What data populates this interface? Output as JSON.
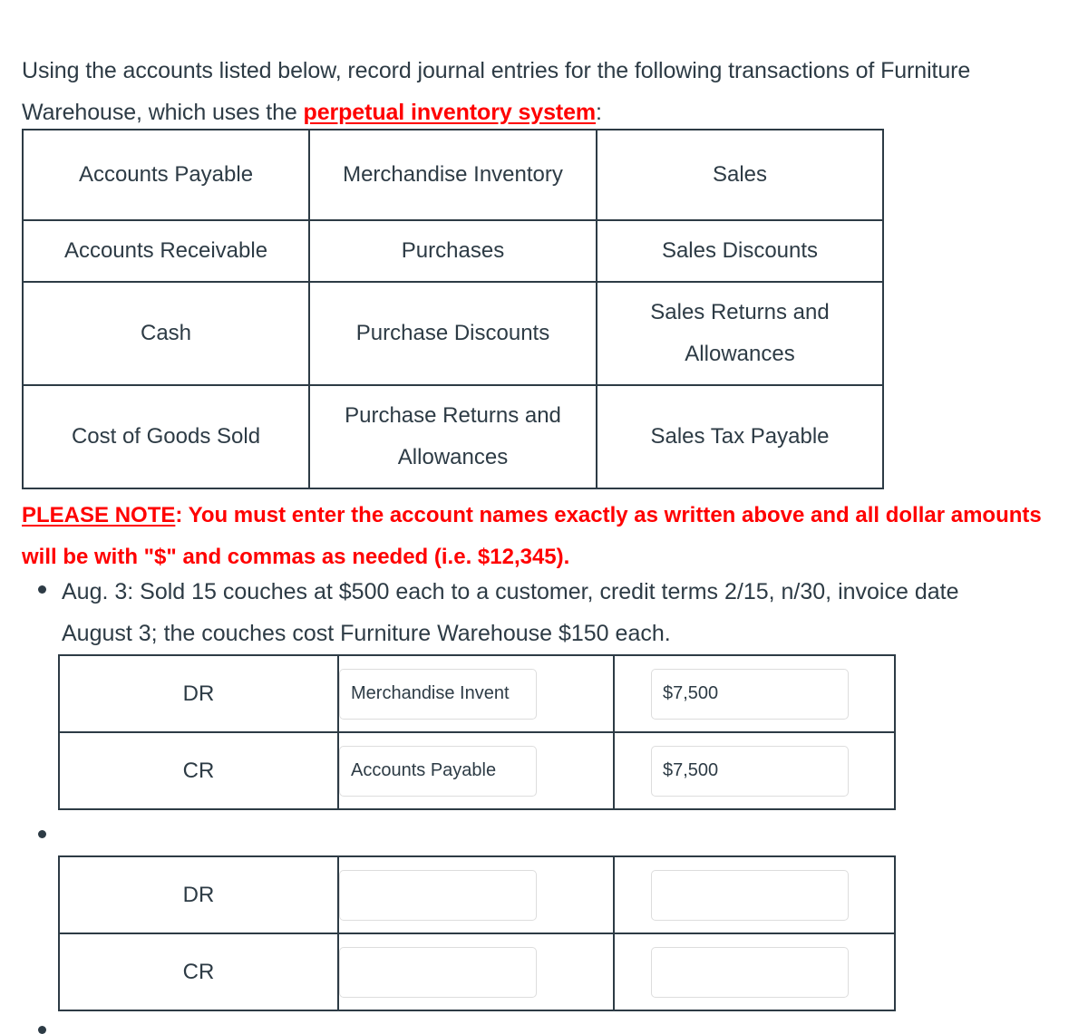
{
  "intro": {
    "part1": "Using the accounts listed below, record journal entries for the following transactions of Furniture Warehouse, which uses the ",
    "emphasis": "perpetual inventory system",
    "part2": ":"
  },
  "accounts_table": {
    "rows": [
      [
        "Accounts Payable",
        "Merchandise Inventory",
        "Sales"
      ],
      [
        "Accounts Receivable",
        "Purchases",
        "Sales Discounts"
      ],
      [
        "Cash",
        "Purchase Discounts",
        "Sales Returns and Allowances"
      ],
      [
        "Cost of Goods Sold",
        "Purchase Returns and Allowances",
        "Sales Tax Payable"
      ]
    ]
  },
  "note": {
    "label": "PLEASE NOTE",
    "text": ": You must enter the account names exactly as written above and all dollar amounts will be with \"$\" and commas as needed (i.e. $12,345)."
  },
  "transactions": [
    {
      "text": "Aug. 3: Sold 15 couches at $500 each to a customer, credit terms 2/15, n/30, invoice date August 3; the couches cost Furniture Warehouse $150 each.",
      "entry_rows": [
        {
          "type": "DR",
          "account": "Merchandise Invent",
          "amount": "$7,500"
        },
        {
          "type": "CR",
          "account": "Accounts Payable",
          "amount": "$7,500"
        }
      ]
    },
    {
      "text": "",
      "entry_rows": [
        {
          "type": "DR",
          "account": "",
          "amount": ""
        },
        {
          "type": "CR",
          "account": "",
          "amount": ""
        }
      ]
    }
  ],
  "colors": {
    "text": "#2D3B45",
    "accent_red": "#FF0000",
    "border": "#2D3B45",
    "input_border": "#DDDDDD"
  }
}
